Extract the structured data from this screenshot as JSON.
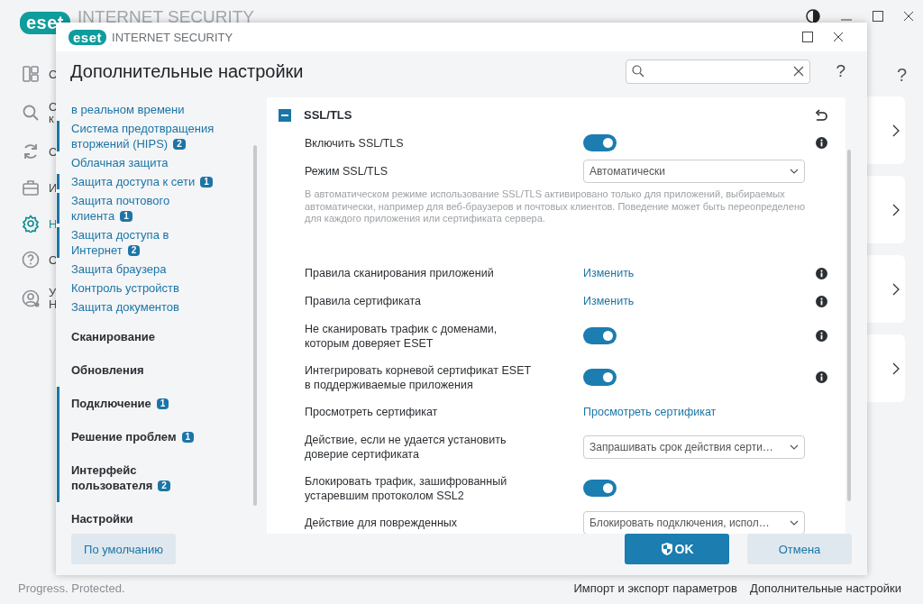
{
  "app": {
    "logo": "eset",
    "title": "INTERNET SECURITY",
    "nav": [
      {
        "lines": [
          "С"
        ],
        "selected": false
      },
      {
        "lines": [
          "С",
          "к"
        ],
        "selected": false
      },
      {
        "lines": [
          "С"
        ],
        "selected": false
      },
      {
        "lines": [
          "И"
        ],
        "selected": false
      },
      {
        "lines": [
          "Н"
        ],
        "selected": true
      },
      {
        "lines": [
          "С"
        ],
        "selected": false
      },
      {
        "lines": [
          "У",
          "Н"
        ],
        "selected": false
      }
    ],
    "help": "?",
    "status": "Progress. Protected.",
    "links": [
      "Импорт и экспорт параметров",
      "Дополнительные настройки"
    ]
  },
  "dialog": {
    "logo": "eset",
    "title": "INTERNET SECURITY",
    "heading": "Дополнительные настройки",
    "help": "?",
    "nav": [
      {
        "children": [
          {
            "label": "в реальном времени",
            "changed": false
          },
          {
            "label": "Система предотвращения вторжений (HIPS)",
            "badge": "2",
            "changed": true
          },
          {
            "label": "Облачная защита",
            "changed": false
          },
          {
            "label": "Защита доступа к сети",
            "badge": "1",
            "changed": true
          },
          {
            "label": "Защита почтового клиента",
            "badge": "1",
            "changed": true
          },
          {
            "label": "Защита доступа в Интернет",
            "badge": "2",
            "changed": true
          },
          {
            "label": "Защита браузера",
            "changed": false
          },
          {
            "label": "Контроль устройств",
            "changed": false
          },
          {
            "label": "Защита документов",
            "changed": false
          }
        ]
      },
      {
        "label": "Сканирование",
        "changed": false
      },
      {
        "label": "Обновления",
        "changed": false
      },
      {
        "label": "Подключение",
        "badge": "1",
        "changed": true
      },
      {
        "label": "Решение проблем",
        "badge": "1",
        "changed": true
      },
      {
        "label": "Интерфейс пользователя",
        "badge": "2",
        "changed": true
      },
      {
        "label": "Настройки",
        "changed": false
      }
    ],
    "section": {
      "title": "SSL/TLS",
      "expanded": true,
      "rows": [
        {
          "kind": "toggle",
          "label": "Включить SSL/TLS",
          "on": true,
          "info": true
        },
        {
          "kind": "select",
          "label": "Режим SSL/TLS",
          "value": "Автоматически",
          "info": false
        },
        {
          "kind": "note",
          "text": "В автоматическом режиме использование SSL/TLS активировано только для приложений, выбираемых автоматически, например для веб-браузеров и почтовых клиентов. Поведение может быть переопределено для каждого приложения или сертификата сервера."
        },
        {
          "kind": "link",
          "label": "Правила сканирования приложений",
          "value": "Изменить",
          "info": true
        },
        {
          "kind": "link",
          "label": "Правила сертификата",
          "value": "Изменить",
          "info": true
        },
        {
          "kind": "toggle",
          "label": "Не сканировать трафик с доменами, которым доверяет ESET",
          "on": true,
          "info": true
        },
        {
          "kind": "toggle",
          "label": "Интегрировать корневой сертификат ESET в поддерживаемые приложения",
          "on": true,
          "info": true
        },
        {
          "kind": "link",
          "label": "Просмотреть сертификат",
          "value": "Просмотреть сертификат",
          "info": false
        },
        {
          "kind": "select",
          "label": "Действие, если не удается установить доверие сертификата",
          "value": "Запрашивать срок действия серти…",
          "info": false
        },
        {
          "kind": "toggle",
          "label": "Блокировать трафик, зашифрованный устаревшим протоколом SSL2",
          "on": true,
          "info": false
        },
        {
          "kind": "select",
          "label": "Действие для поврежденных",
          "value": "Блокировать подключения, испол…",
          "info": false
        }
      ]
    },
    "buttons": [
      {
        "label": "По умолчанию",
        "kind": "secondary"
      },
      {
        "label": "OK",
        "kind": "primary"
      },
      {
        "label": "Отмена",
        "kind": "secondary"
      }
    ]
  }
}
